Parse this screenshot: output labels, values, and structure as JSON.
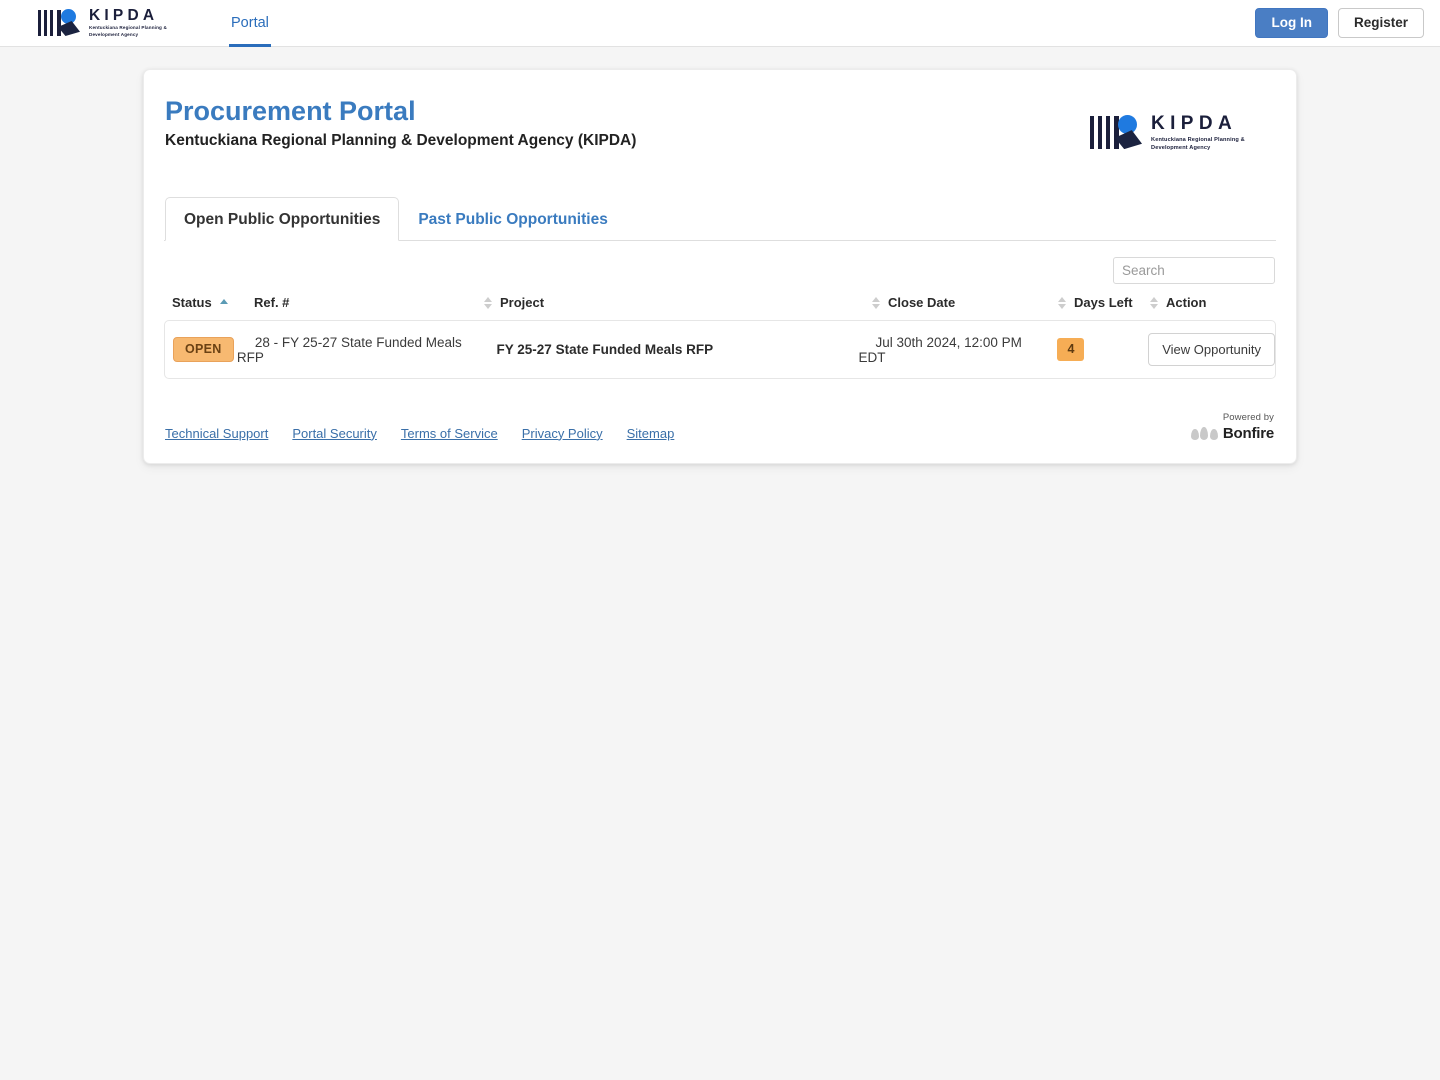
{
  "topnav": {
    "logo": {
      "name": "KIPDA",
      "tagline": "Kentuckiana Regional Planning & Development Agency",
      "icon": "kipda-logo"
    },
    "tab_label": "Portal",
    "login_label": "Log In",
    "register_label": "Register"
  },
  "header": {
    "title": "Procurement Portal",
    "subtitle": "Kentuckiana Regional Planning & Development Agency (KIPDA)",
    "logo": {
      "name": "KIPDA",
      "tagline": "Kentuckiana Regional Planning & Development Agency"
    }
  },
  "tabs": [
    {
      "label": "Open Public Opportunities",
      "active": true
    },
    {
      "label": "Past Public Opportunities",
      "active": false
    }
  ],
  "search": {
    "value": "",
    "placeholder": "Search"
  },
  "table": {
    "columns": [
      {
        "label": "Status",
        "sort": "asc"
      },
      {
        "label": "Ref. #",
        "sort": "none"
      },
      {
        "label": "Project",
        "sort": "none"
      },
      {
        "label": "Close Date",
        "sort": "none"
      },
      {
        "label": "Days Left",
        "sort": "none"
      },
      {
        "label": "Action",
        "sort": "none"
      }
    ],
    "rows": [
      {
        "status": "OPEN",
        "ref": "28 - FY 25-27 State Funded Meals RFP",
        "project": "FY 25-27 State Funded Meals RFP",
        "close_date": "Jul 30th 2024, 12:00 PM EDT",
        "days_left": "4",
        "action_label": "View Opportunity"
      }
    ]
  },
  "footer": {
    "links": [
      {
        "label": "Technical Support"
      },
      {
        "label": "Portal Security"
      },
      {
        "label": "Terms of Service"
      },
      {
        "label": "Privacy Policy"
      },
      {
        "label": "Sitemap"
      }
    ],
    "powered_by": "Powered by",
    "brand": "Bonfire"
  },
  "colors": {
    "accent_blue": "#3a7bbf",
    "login_blue": "#4a7ec4",
    "badge_orange": "#f7b971",
    "days_orange": "#f6ad55",
    "sort_active": "#5b9bb5",
    "page_bg": "#f5f5f5"
  }
}
